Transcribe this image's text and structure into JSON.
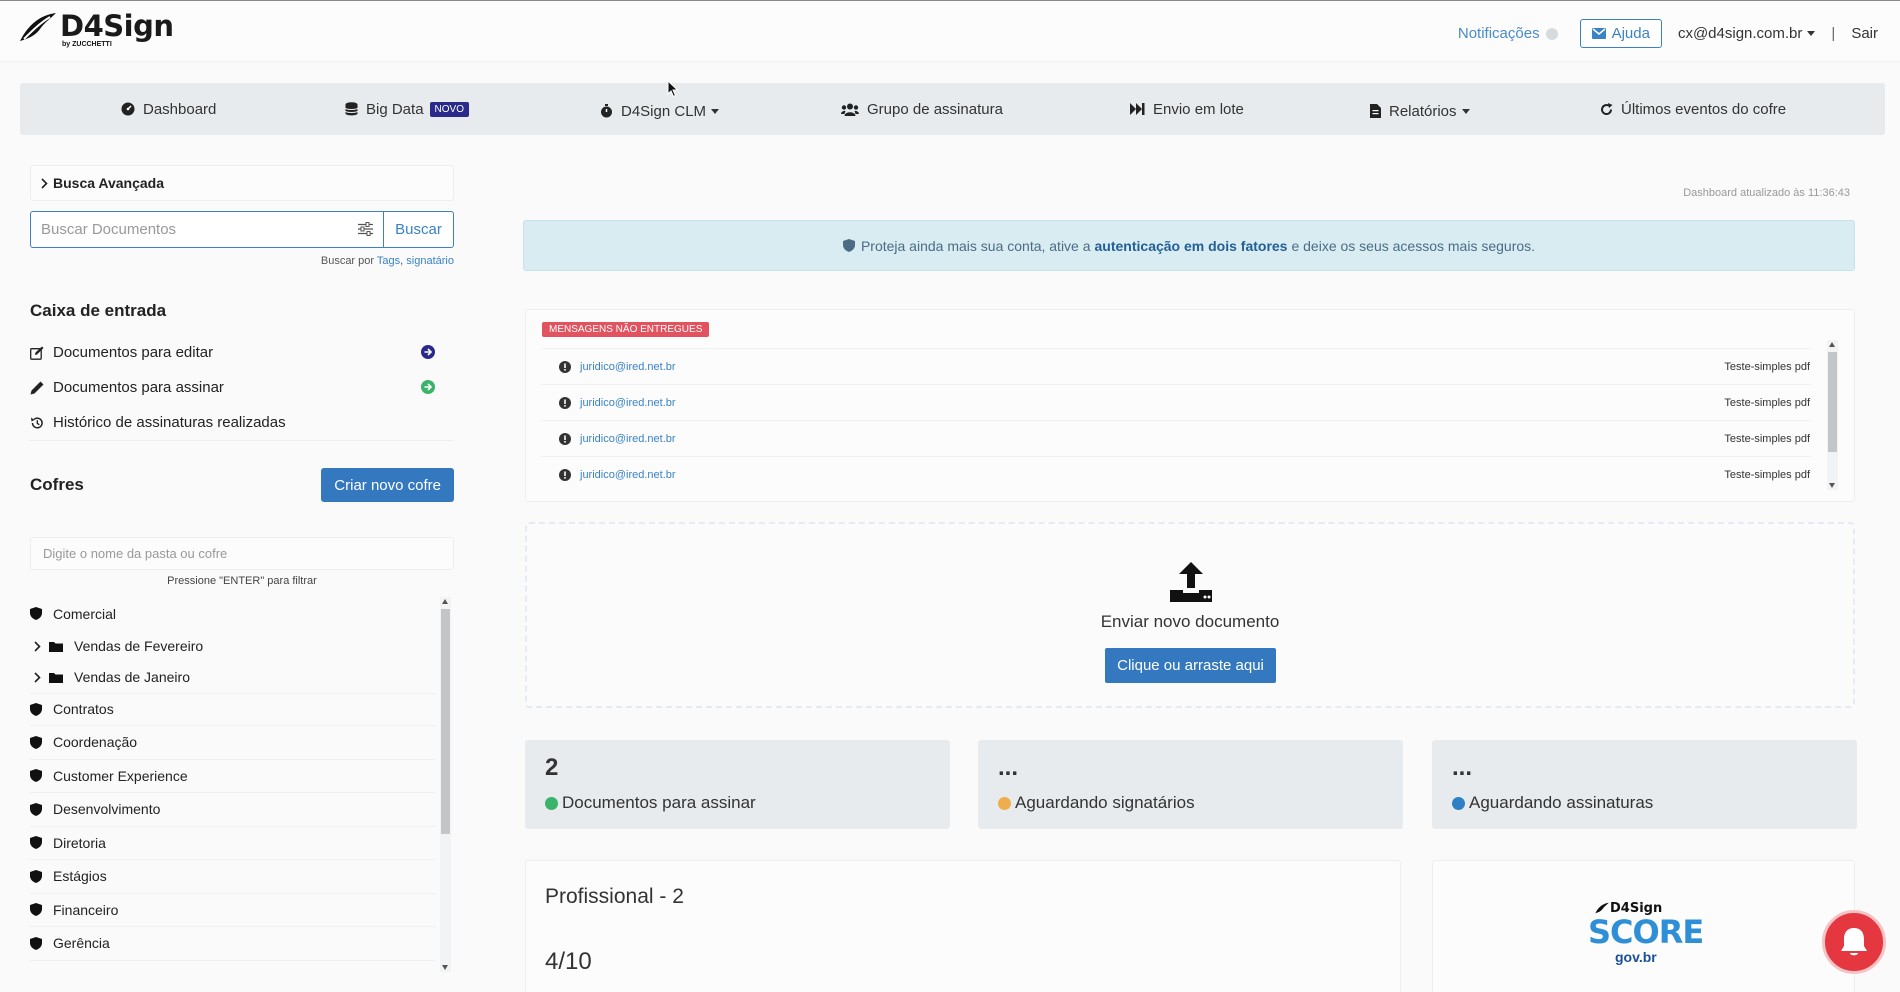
{
  "header": {
    "logo_text": "D4Sign",
    "logo_sub": "by ZUCCHETTI",
    "notifications_label": "Notificações",
    "help_label": "Ajuda",
    "user_email": "cx@d4sign.com.br",
    "separator": "|",
    "logout_label": "Sair"
  },
  "nav": {
    "items": [
      {
        "label": "Dashboard",
        "icon": "dashboard-icon"
      },
      {
        "label": "Big Data",
        "icon": "database-icon",
        "badge": "NOVO"
      },
      {
        "label": "D4Sign CLM",
        "icon": "stopwatch-icon",
        "dropdown": true
      },
      {
        "label": "Grupo de assinatura",
        "icon": "users-icon"
      },
      {
        "label": "Envio em lote",
        "icon": "fast-forward-icon"
      },
      {
        "label": "Relatórios",
        "icon": "file-icon",
        "dropdown": true
      },
      {
        "label": "Últimos eventos do cofre",
        "icon": "refresh-icon"
      }
    ]
  },
  "sidebar": {
    "advanced_search_label": "Busca Avançada",
    "search_placeholder": "Buscar Documentos",
    "search_button": "Buscar",
    "search_hint_prefix": "Buscar por",
    "search_hint_tags": "Tags",
    "search_hint_signer": "signatário",
    "inbox_title": "Caixa de entrada",
    "inbox_items": [
      {
        "label": "Documentos para editar",
        "icon": "edit-icon"
      },
      {
        "label": "Documentos para assinar",
        "icon": "pencil-icon"
      },
      {
        "label": "Histórico de assinaturas realizadas",
        "icon": "history-icon"
      }
    ],
    "vaults_title": "Cofres",
    "new_vault_button": "Criar novo cofre",
    "folder_filter_placeholder": "Digite o nome da pasta ou cofre",
    "filter_hint": "Pressione \"ENTER\" para filtrar",
    "vaults": [
      {
        "label": "Comercial",
        "type": "vault"
      },
      {
        "label": "Vendas de Fevereiro",
        "type": "folder"
      },
      {
        "label": "Vendas de Janeiro",
        "type": "folder"
      },
      {
        "label": "Contratos",
        "type": "vault"
      },
      {
        "label": "Coordenação",
        "type": "vault"
      },
      {
        "label": "Customer Experience",
        "type": "vault"
      },
      {
        "label": "Desenvolvimento",
        "type": "vault"
      },
      {
        "label": "Diretoria",
        "type": "vault"
      },
      {
        "label": "Estágios",
        "type": "vault"
      },
      {
        "label": "Financeiro",
        "type": "vault"
      },
      {
        "label": "Gerência",
        "type": "vault"
      }
    ]
  },
  "main": {
    "updated_text": "Dashboard atualizado às 11:36:43",
    "alert": {
      "before": "Proteja ainda mais sua conta, ative a",
      "link": "autenticação em dois fatores",
      "after": "e deixe os seus acessos mais seguros."
    },
    "undelivered": {
      "badge": "MENSAGENS NÃO ENTREGUES",
      "rows": [
        {
          "email": "juridico@ired.net.br",
          "doc": "Teste-simples pdf"
        },
        {
          "email": "juridico@ired.net.br",
          "doc": "Teste-simples pdf"
        },
        {
          "email": "juridico@ired.net.br",
          "doc": "Teste-simples pdf"
        },
        {
          "email": "juridico@ired.net.br",
          "doc": "Teste-simples pdf"
        }
      ]
    },
    "upload": {
      "title": "Enviar novo documento",
      "button": "Clique ou arraste aqui"
    },
    "stats": [
      {
        "value": "2",
        "label": "Documentos para assinar",
        "color": "#3bb36a"
      },
      {
        "value": "...",
        "label": "Aguardando signatários",
        "color": "#f0ad4e"
      },
      {
        "value": "...",
        "label": "Aguardando assinaturas",
        "color": "#2e7fc4"
      }
    ],
    "plan": {
      "title": "Profissional - 2",
      "usage": "4/10"
    },
    "score": {
      "top": "D4Sign",
      "main": "SCORE",
      "gov": "gov.br"
    }
  },
  "colors": {
    "primary": "#3478c0",
    "nav_bg": "#e7ebee",
    "alert_bg": "#d8ecf2",
    "badge_red": "#e0535f",
    "chat_red": "#e4373f"
  }
}
